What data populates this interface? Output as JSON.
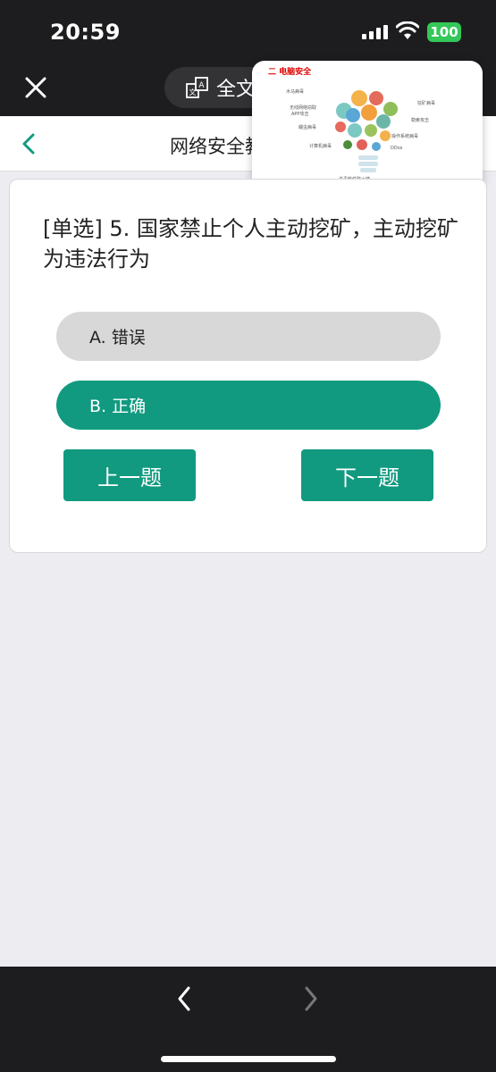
{
  "status_bar": {
    "time": "20:59",
    "battery": "100"
  },
  "top_bar": {
    "fulltext_label": "全文"
  },
  "nav": {
    "title": "网络安全教"
  },
  "pip": {
    "title": "二 电脑安全",
    "labels": [
      "木马病毒",
      "挖矿病毒",
      "无线网络窃取",
      "APP攻击",
      "勒索攻击",
      "蠕虫病毒",
      "操作系统病毒",
      "计算机病毒",
      "DDos",
      "杀毒软件防火墙"
    ]
  },
  "question": {
    "text": "[单选] 5. 国家禁止个人主动挖矿，主动挖矿为违法行为",
    "options": [
      {
        "label": "A. 错误",
        "selected": false
      },
      {
        "label": "B. 正确",
        "selected": true
      }
    ]
  },
  "buttons": {
    "prev": "上一题",
    "next": "下一题"
  },
  "colors": {
    "accent": "#119a80",
    "dark_bg": "#1d1d1f",
    "battery": "#34c759"
  }
}
